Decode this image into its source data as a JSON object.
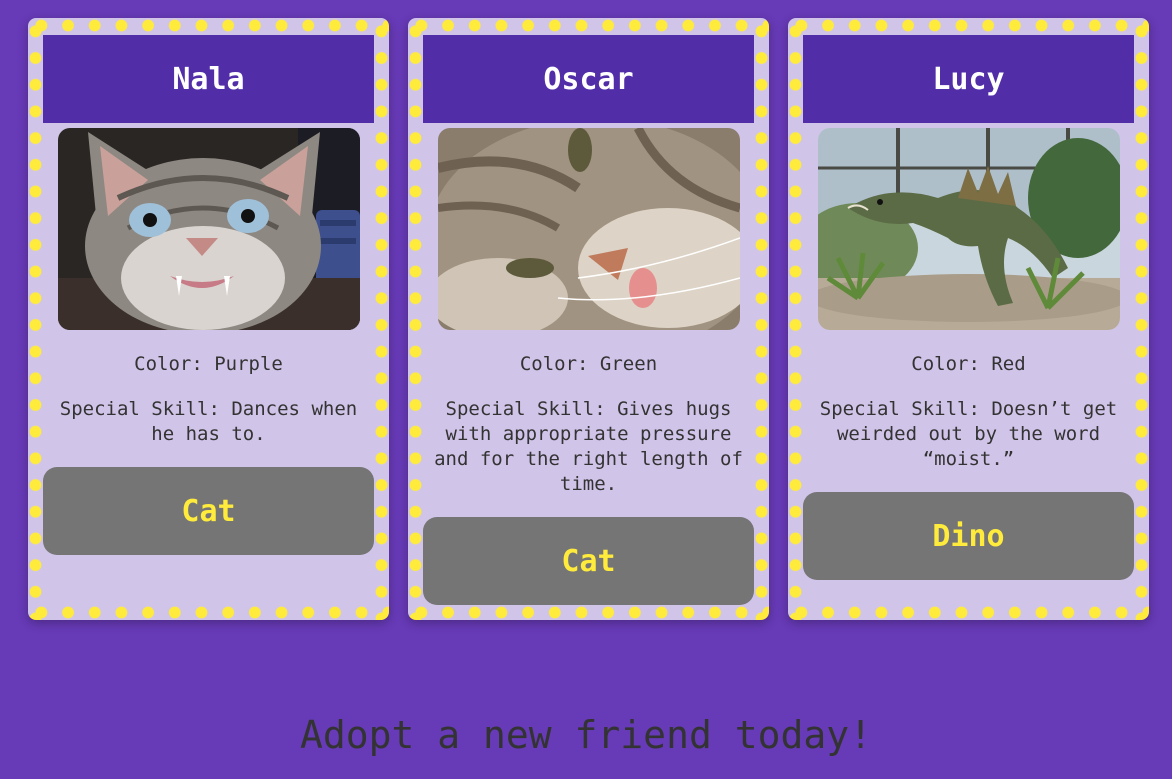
{
  "pets": [
    {
      "name": "Nala",
      "color_text": "Color: Purple",
      "skill_text": "Special Skill: Dances when he has to.",
      "type_label": "Cat",
      "photo_icon": "grumpy-cat-photo"
    },
    {
      "name": "Oscar",
      "color_text": "Color: Green",
      "skill_text": "Special Skill: Gives hugs with appropriate pressure and for the right length of time.",
      "type_label": "Cat",
      "photo_icon": "sleepy-cat-photo"
    },
    {
      "name": "Lucy",
      "color_text": "Color: Red",
      "skill_text": "Special Skill: Doesn’t get weirded out by the word “moist.”",
      "type_label": "Dino",
      "photo_icon": "dinosaur-photo"
    }
  ],
  "footer": {
    "tagline": "Adopt a new friend today!"
  },
  "colors": {
    "page_background": "#673ab7",
    "card_background": "#d1c4e9",
    "card_dots": "#ffeb3b",
    "header_background": "#512da8",
    "button_background": "#757575",
    "button_text": "#ffeb3b"
  }
}
